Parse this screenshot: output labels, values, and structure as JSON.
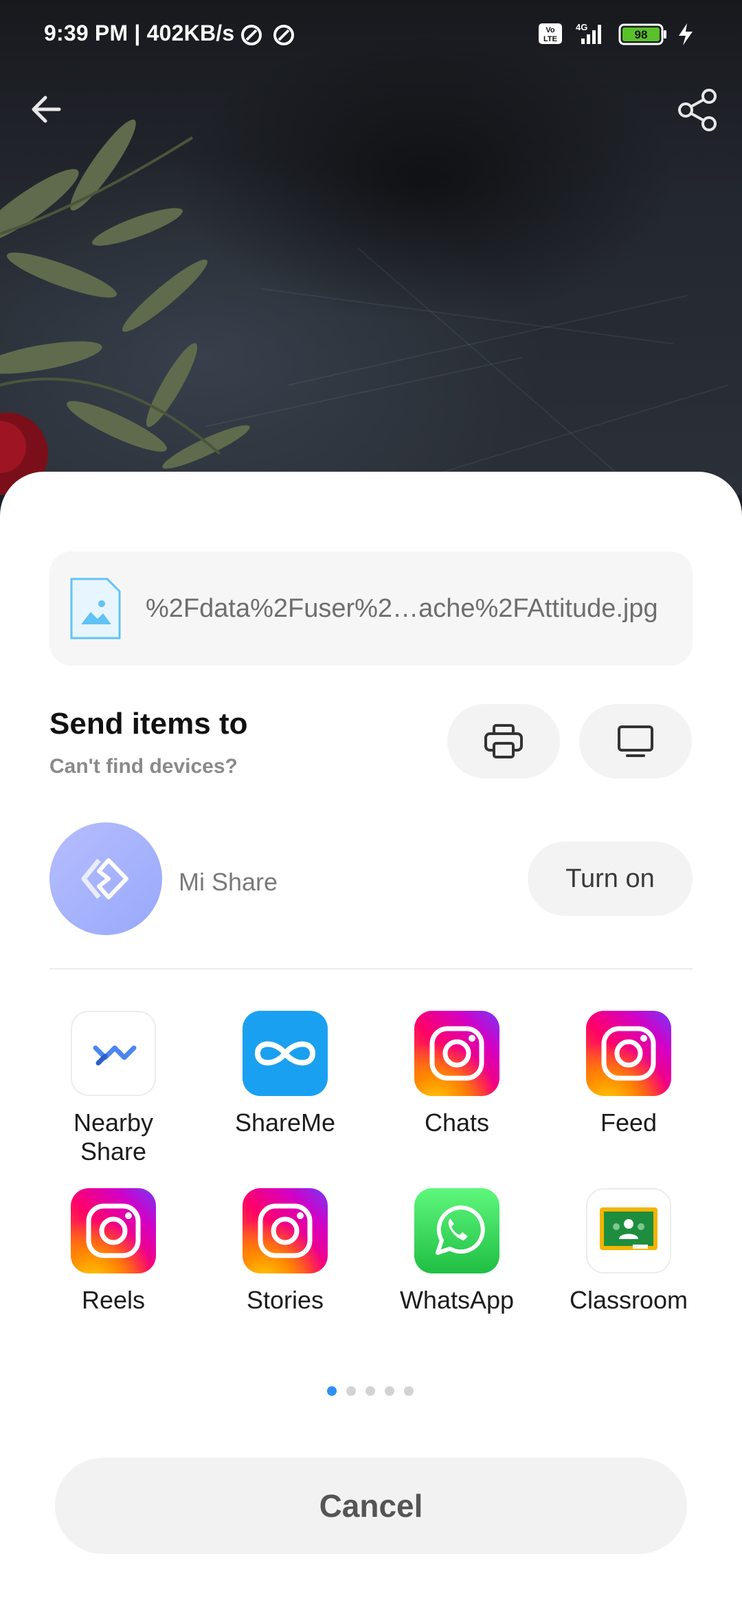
{
  "status_bar": {
    "time": "9:39 PM | 402KB/s",
    "network": "4G",
    "battery": "98",
    "icons": [
      "vpn-icon",
      "volte-icon",
      "signal-icon",
      "battery-icon",
      "charging-icon"
    ]
  },
  "header": {
    "back_icon": "arrow-left-icon",
    "share_icon": "share-icon"
  },
  "sheet": {
    "file_name": "%2Fdata%2Fuser%2…ache%2FAttitude.jpg",
    "file_icon": "image-file-icon",
    "send_title": "Send items to",
    "send_subtitle": "Can't find devices?",
    "print_icon": "printer-icon",
    "screen_icon": "monitor-icon",
    "mi_share": {
      "label": "Mi Share",
      "button": "Turn on"
    },
    "apps": [
      {
        "label": "Nearby\nShare",
        "icon": "nearby-share-icon"
      },
      {
        "label": "ShareMe",
        "icon": "shareme-icon"
      },
      {
        "label": "Chats",
        "icon": "instagram-icon"
      },
      {
        "label": "Feed",
        "icon": "instagram-icon"
      },
      {
        "label": "Reels",
        "icon": "instagram-icon"
      },
      {
        "label": "Stories",
        "icon": "instagram-icon"
      },
      {
        "label": "WhatsApp",
        "icon": "whatsapp-icon"
      },
      {
        "label": "Classroom",
        "icon": "google-classroom-icon"
      }
    ],
    "pages": {
      "count": 5,
      "current": 1
    },
    "cancel": "Cancel"
  },
  "colors": {
    "accent": "#2f8ff5",
    "mi_share": "#a3b0fc",
    "shareme": "#1aa0f0",
    "whatsapp": "#25d366",
    "classroom_green": "#1e8e3e",
    "classroom_yellow": "#f4b400"
  }
}
